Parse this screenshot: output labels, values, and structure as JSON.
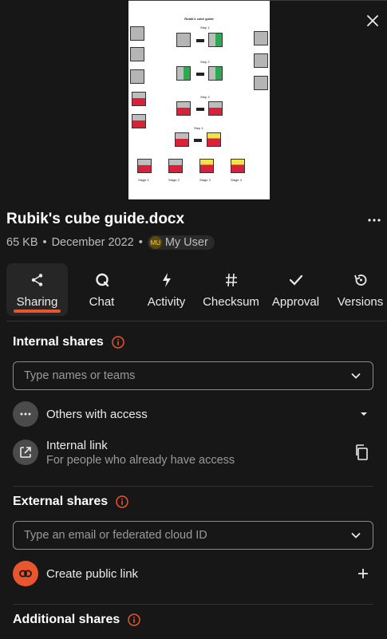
{
  "file": {
    "name": "Rubik's cube guide.docx",
    "size": "65 KB",
    "date": "December 2022",
    "owner_initials": "MU",
    "owner_name": "My User"
  },
  "preview": {
    "doc_title": "Rubik's cube guide",
    "step_labels": [
      "Step 1",
      "Step 2",
      "Step 3",
      "Step 4"
    ],
    "stage_labels": [
      "Stage 1",
      "Stage 2",
      "Stage 3",
      "Stage 4"
    ]
  },
  "tabs": [
    {
      "label": "Sharing",
      "icon": "share-icon",
      "active": true
    },
    {
      "label": "Chat",
      "icon": "chat-icon"
    },
    {
      "label": "Activity",
      "icon": "activity-icon"
    },
    {
      "label": "Checksum",
      "icon": "hash-icon"
    },
    {
      "label": "Approval",
      "icon": "check-icon"
    },
    {
      "label": "Versions",
      "icon": "history-icon"
    }
  ],
  "internal": {
    "title": "Internal shares",
    "placeholder": "Type names or teams",
    "others_label": "Others with access",
    "link_title": "Internal link",
    "link_sub": "For people who already have access"
  },
  "external": {
    "title": "External shares",
    "placeholder": "Type an email or federated cloud ID",
    "public_link_label": "Create public link"
  },
  "additional": {
    "title": "Additional shares"
  },
  "colors": {
    "accent": "#e9552c",
    "background": "#171717"
  }
}
